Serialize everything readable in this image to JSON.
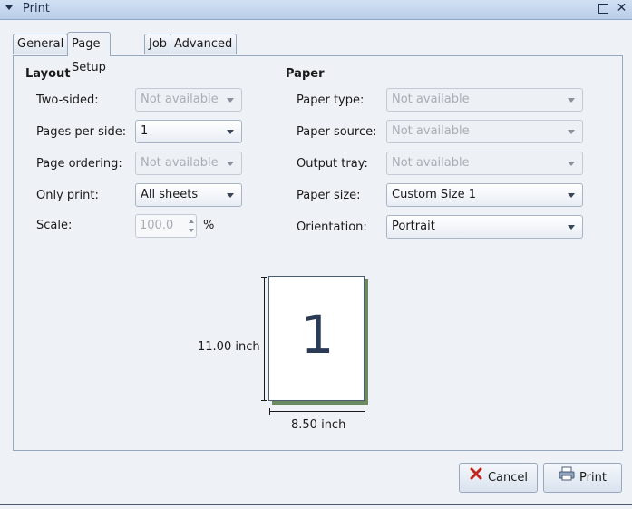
{
  "window": {
    "title": "Print"
  },
  "tabs": [
    {
      "label": "General",
      "active": false
    },
    {
      "label": "Page Setup",
      "active": true
    },
    {
      "label": "Job",
      "active": false
    },
    {
      "label": "Advanced",
      "active": false
    }
  ],
  "layout": {
    "title": "Layout",
    "two_sided": {
      "label": "Two-sided:",
      "value": "Not available"
    },
    "pages_per_side": {
      "label": "Pages per side:",
      "value": "1"
    },
    "page_ordering": {
      "label": "Page ordering:",
      "value": "Not available"
    },
    "only_print": {
      "label": "Only print:",
      "value": "All sheets"
    },
    "scale": {
      "label": "Scale:",
      "value": "100.0",
      "unit": "%"
    }
  },
  "paper": {
    "title": "Paper",
    "paper_type": {
      "label": "Paper type:",
      "value": "Not available"
    },
    "paper_source": {
      "label": "Paper source:",
      "value": "Not available"
    },
    "output_tray": {
      "label": "Output tray:",
      "value": "Not available"
    },
    "paper_size": {
      "label": "Paper size:",
      "value": "Custom Size 1"
    },
    "orientation": {
      "label": "Orientation:",
      "value": "Portrait"
    }
  },
  "preview": {
    "page_number": "1",
    "height_label": "11.00 inch",
    "width_label": "8.50 inch"
  },
  "buttons": {
    "cancel": "Cancel",
    "print": "Print"
  },
  "icons": {
    "cancel": "cancel-x-icon",
    "print": "printer-icon"
  },
  "colors": {
    "titlebar": "#c4d6ee",
    "panel_bg": "#eef1f5",
    "cancel_icon": "#c0251d"
  }
}
